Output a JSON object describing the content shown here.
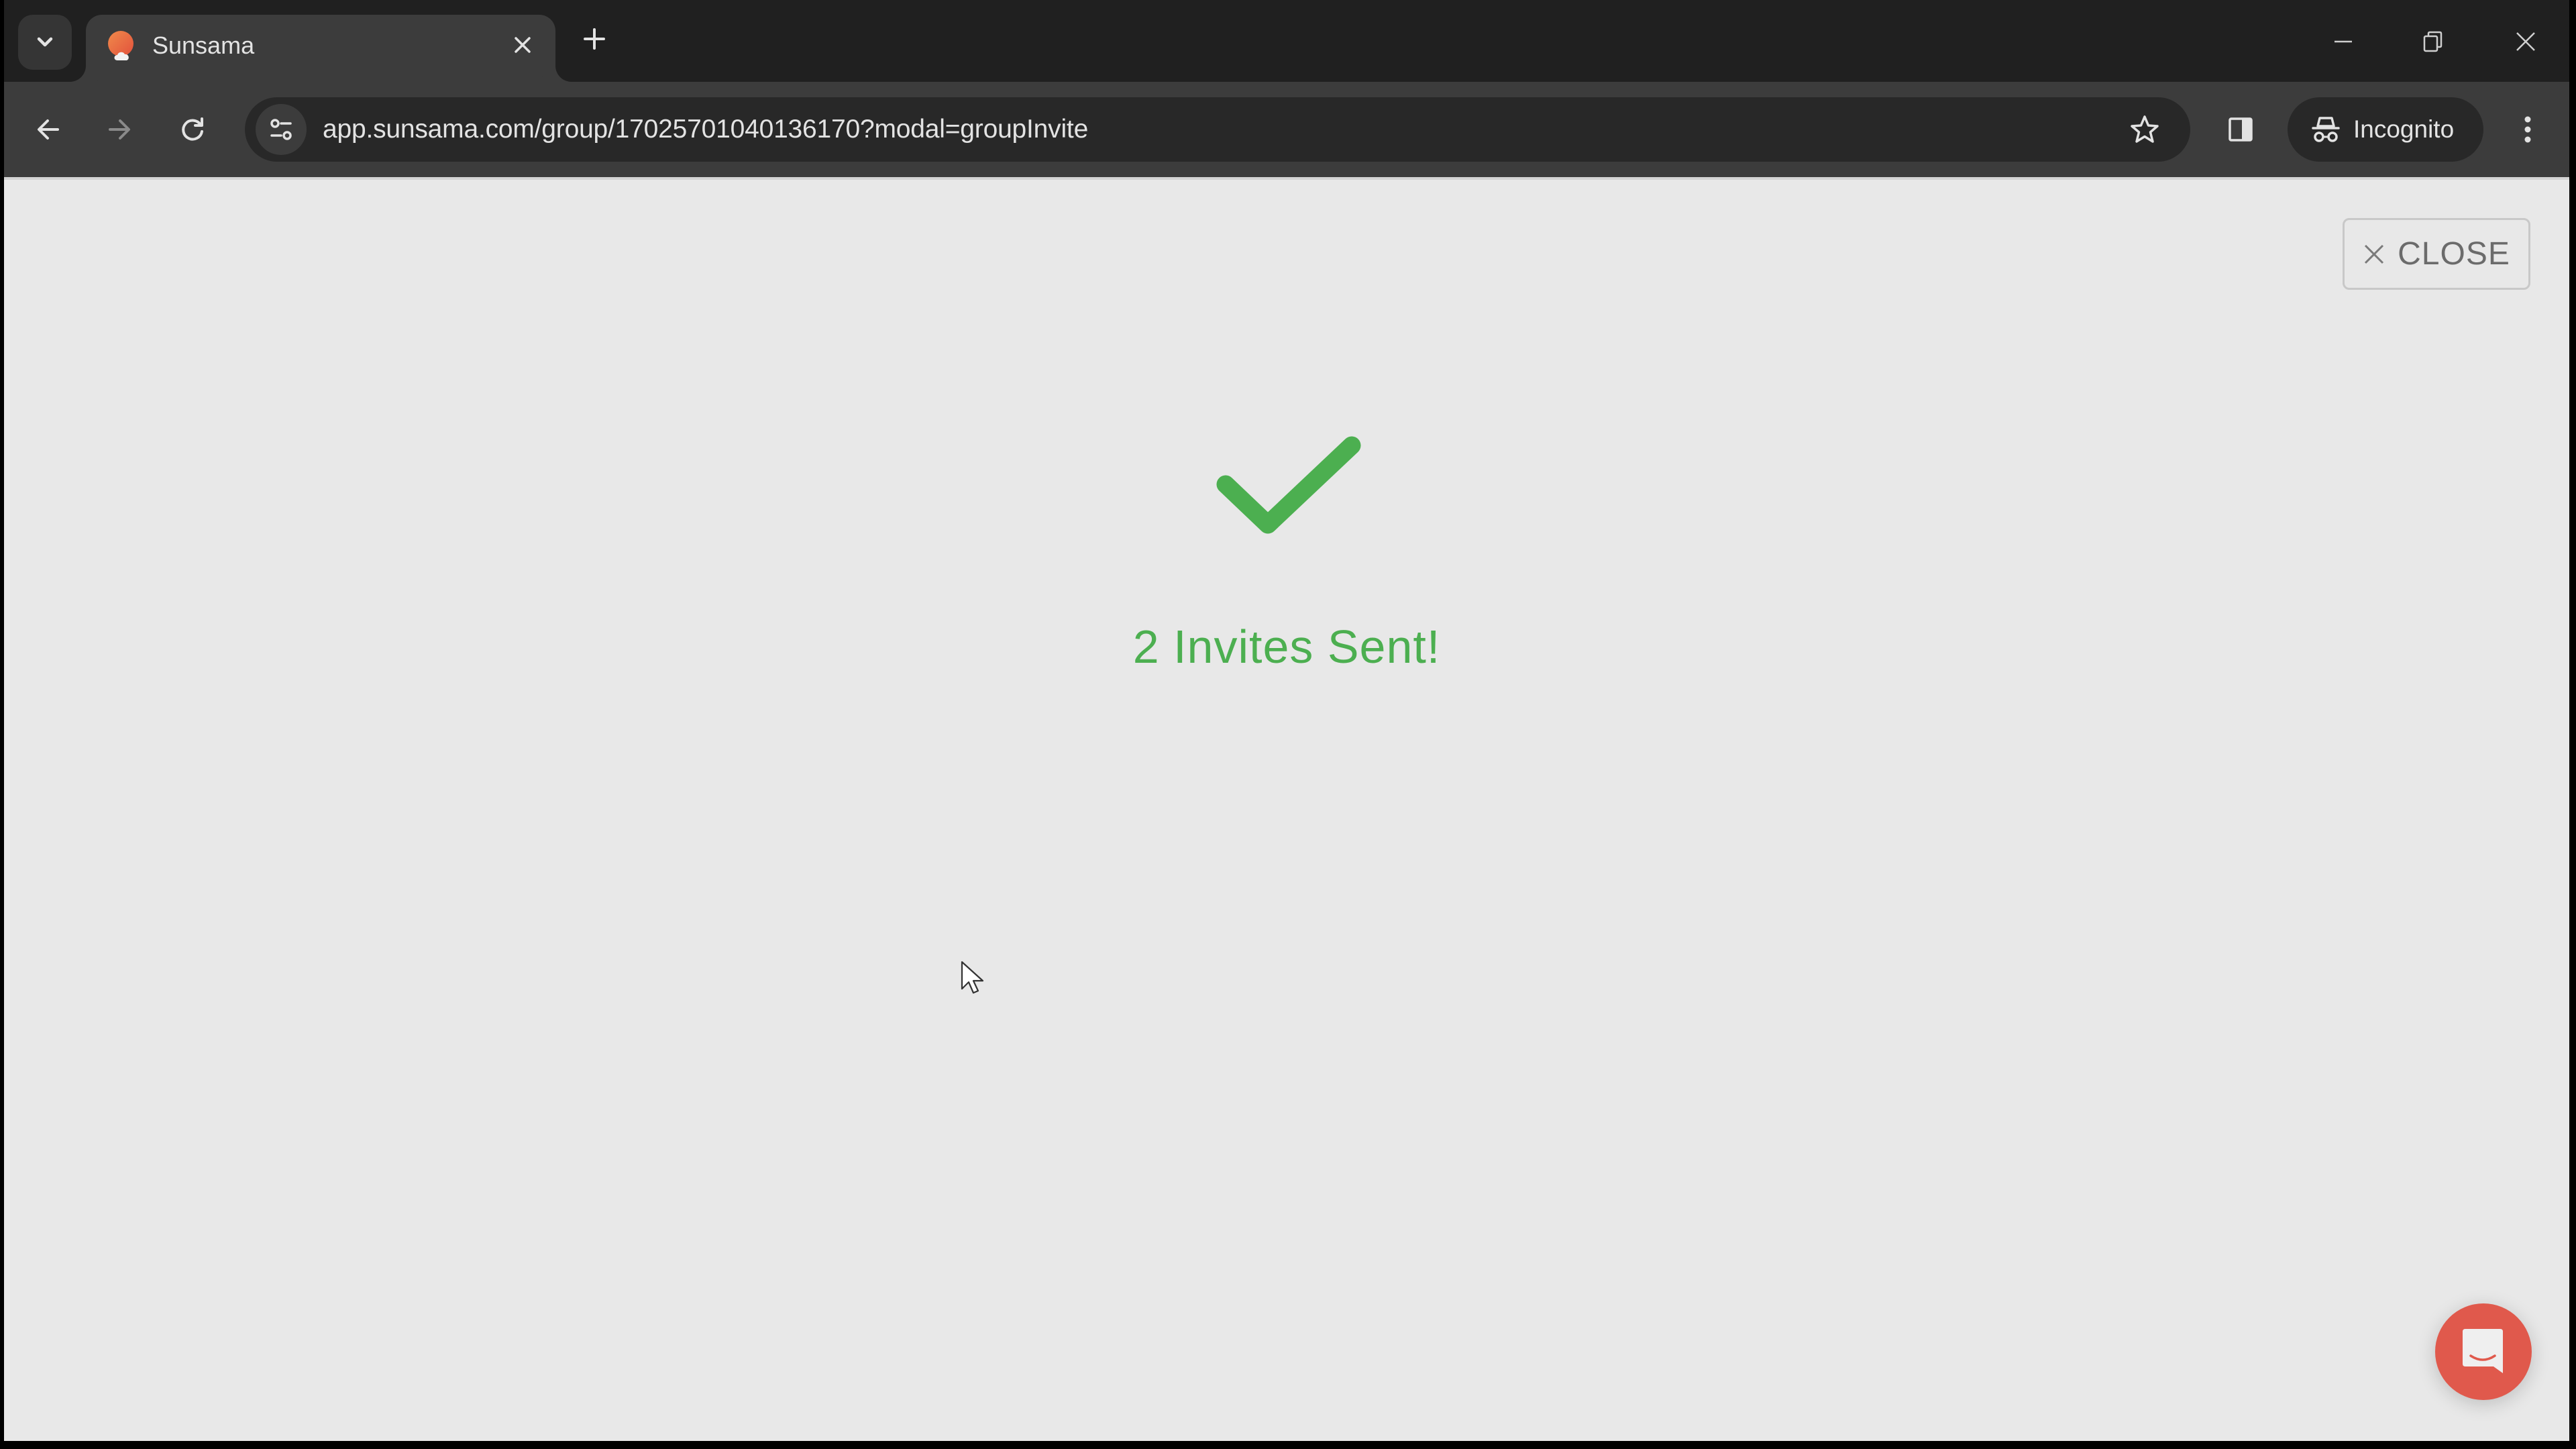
{
  "browser": {
    "tab": {
      "title": "Sunsama",
      "favicon": "sunsama-sun-cloud-icon"
    },
    "url": "app.sunsama.com/group/17025701040136170?modal=groupInvite",
    "profile_label": "Incognito",
    "icons": {
      "tab_search": "chevron-down-icon",
      "tab_close": "close-icon",
      "new_tab": "plus-icon",
      "minimize": "minimize-icon",
      "restore": "restore-icon",
      "window_close": "close-icon",
      "back": "arrow-left-icon",
      "forward": "arrow-right-icon",
      "reload": "reload-icon",
      "site_info": "tune-icon",
      "bookmark": "star-icon",
      "side_panel": "side-panel-icon",
      "incognito": "incognito-icon",
      "menu": "more-vert-icon"
    }
  },
  "modal": {
    "close_label": "CLOSE",
    "success_message": "2 Invites Sent!",
    "success_icon": "check-icon",
    "colors": {
      "success": "#4caf50",
      "chat_button": "#e0594c",
      "background": "#e8e8e8"
    }
  },
  "support_chat": {
    "icon": "chat-bubble-smile-icon"
  }
}
